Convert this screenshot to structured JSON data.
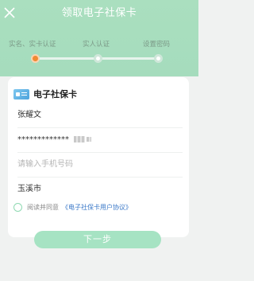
{
  "header": {
    "title": "领取电子社保卡"
  },
  "steps": [
    {
      "label": "实名、实卡认证"
    },
    {
      "label": "实人认证"
    },
    {
      "label": "设置密码"
    }
  ],
  "card": {
    "title": "电子社保卡",
    "name": "张耀文",
    "id_number": "*************",
    "phone_placeholder": "请输入手机号码",
    "city": "玉溪市"
  },
  "agreement": {
    "text": "阅读并同意",
    "link": "《电子社保卡用户协议》"
  },
  "next_button": "下一步",
  "colors": {
    "header": "#a8ddbe",
    "active_step": "#f08a32",
    "button": "#a6e3c3",
    "link": "#3a78c8"
  }
}
